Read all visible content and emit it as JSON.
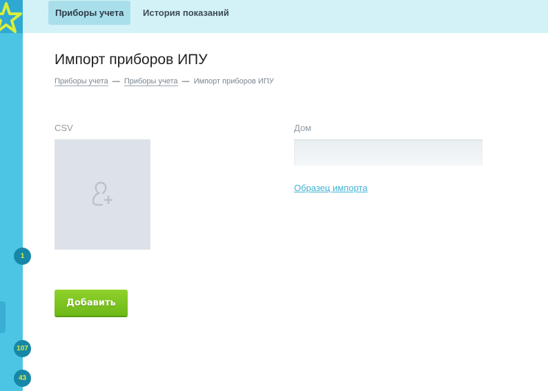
{
  "colors": {
    "sidebar": "#4cc4e4",
    "topbar": "#d3f2f8",
    "accent_link": "#3fb2d2",
    "button_green": "#7cc521",
    "badge_bg": "#1787a8",
    "badge_text": "#d9ee3a"
  },
  "sidebar": {
    "logo_icon": "star-logo-icon",
    "badges": [
      "1",
      "107",
      "43"
    ]
  },
  "topbar": {
    "tabs": [
      {
        "label": "Приборы учета",
        "active": true
      },
      {
        "label": "История показаний",
        "active": false
      }
    ]
  },
  "page": {
    "title": "Импорт приборов ИПУ",
    "breadcrumb": {
      "items": [
        "Приборы учета",
        "Приборы учета"
      ],
      "separator": "—",
      "current": "Импорт приборов ИПУ"
    }
  },
  "form": {
    "csv_label": "CSV",
    "upload_icon": "add-user-icon",
    "house_label": "Дом",
    "house_value": "",
    "sample_link": "Образец импорта",
    "submit_label": "Добавить"
  }
}
